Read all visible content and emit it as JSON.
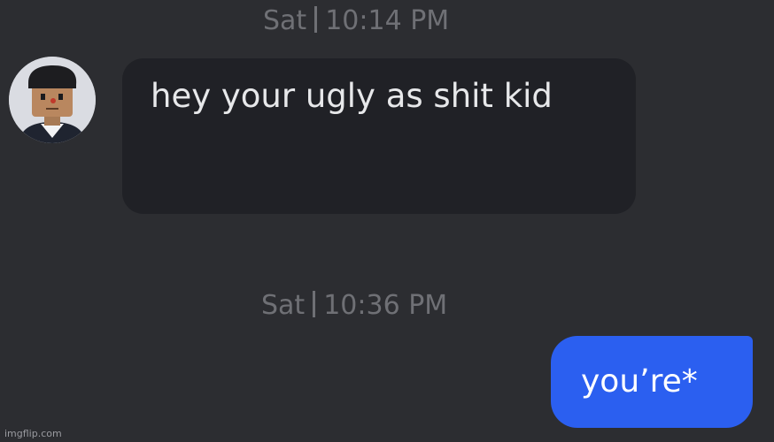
{
  "messages": [
    {
      "timestamp_day": "Sat",
      "timestamp_time": "10:14 PM",
      "sender": "other",
      "text": "hey your ugly as shit kid"
    },
    {
      "timestamp_day": "Sat",
      "timestamp_time": "10:36 PM",
      "sender": "self",
      "text": "you’re*"
    }
  ],
  "icons": {
    "avatar": "avatar-icon"
  },
  "watermark": "imgflip.com",
  "colors": {
    "background": "#2c2d31",
    "incoming_bubble": "#202126",
    "outgoing_bubble": "#2b5ff0",
    "timestamp_text": "#6f7075",
    "message_text": "#e7e8ea"
  }
}
